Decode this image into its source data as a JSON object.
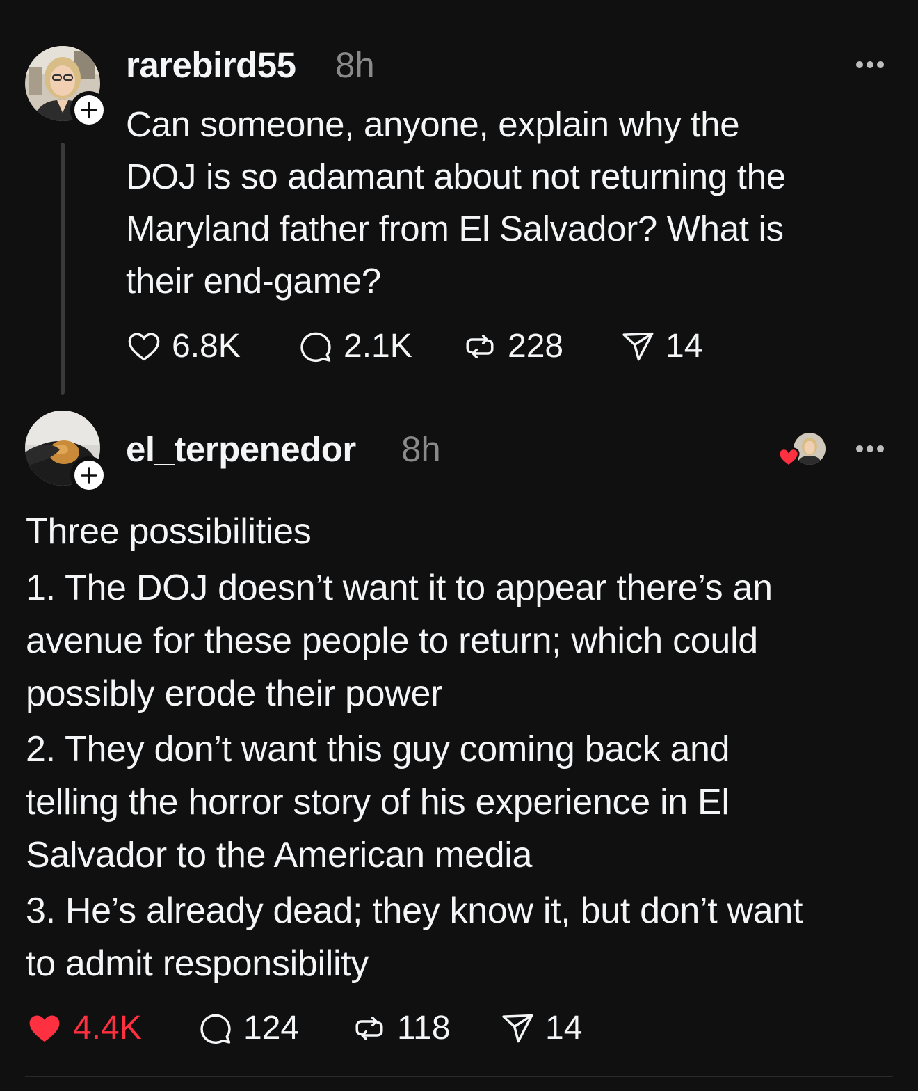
{
  "colors": {
    "background": "#101010",
    "text": "#f3f5f7",
    "muted": "#8a8a8a",
    "like_red": "#ff3040"
  },
  "post": {
    "username": "rarebird55",
    "time": "8h",
    "text_lines": [
      "Can someone, anyone, explain why the",
      "DOJ is so adamant about not returning the",
      "Maryland father from El Salvador? What is",
      "their end-game?"
    ],
    "actions": {
      "likes": "6.8K",
      "replies": "2.1K",
      "reposts": "228",
      "shares": "14"
    },
    "icons": {
      "like": "heart-outline-icon",
      "reply": "speech-bubble-icon",
      "repost": "repost-icon",
      "share": "paper-plane-icon",
      "follow": "plus-icon",
      "more": "more-horizontal-icon"
    }
  },
  "reply": {
    "username": "el_terpenedor",
    "time": "8h",
    "text_lines": [
      "Three possibilities",
      "1. The DOJ doesn’t want it to appear there’s an",
      "avenue for these people to return; which could",
      "possibly erode their power",
      "2. They don’t want this guy coming back and",
      "telling the horror story of his experience in El",
      "Salvador to the American media",
      "3. He’s already dead; they know it, but don’t want",
      "to admit responsibility"
    ],
    "actions": {
      "likes": "4.4K",
      "liked": true,
      "replies": "124",
      "reposts": "118",
      "shares": "14"
    },
    "icons": {
      "like": "heart-filled-icon",
      "reply": "speech-bubble-icon",
      "repost": "repost-icon",
      "share": "paper-plane-icon",
      "follow": "plus-icon",
      "more": "more-horizontal-icon",
      "author_liked": "author-liked-heart-icon"
    }
  }
}
